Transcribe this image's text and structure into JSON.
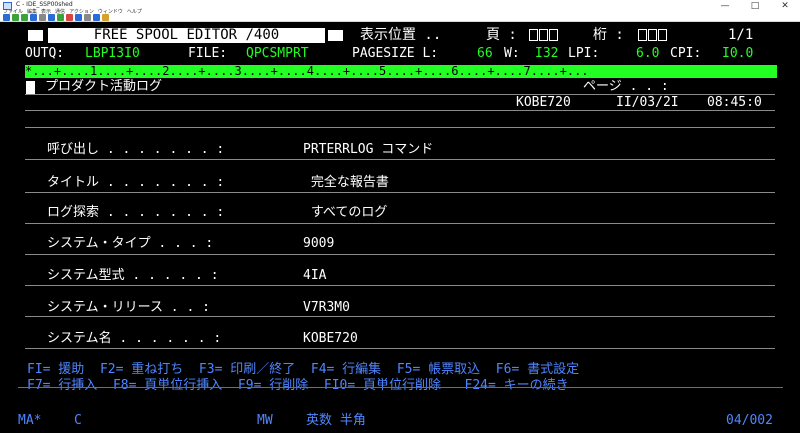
{
  "window": {
    "title": "C - IDE_SSP00shed",
    "menu": [
      "ファイル",
      "編集",
      "表示",
      "通信",
      "アクション",
      "ウィンドウ",
      "ヘルプ"
    ],
    "controls": [
      "—",
      "□",
      "✕"
    ]
  },
  "header": {
    "editor_title": "FREE SPOOL EDITOR /400",
    "position_label": "表示位置 ..",
    "page_label": "頁 :",
    "column_label": "桁 :",
    "page_count": "1/1"
  },
  "file_info": {
    "outq_label": "OUTQ:",
    "outq_value": "LBPI3I0",
    "file_label": "FILE:",
    "file_value": "QPCSMPRT",
    "pagesize_label": "PAGESIZE L:",
    "pagesize_l": "66",
    "w_label": "W:",
    "w_value": "I32",
    "lpi_label": "LPI:",
    "lpi_value": "6.0",
    "cpi_label": "CPI:",
    "cpi_value": "I0.0"
  },
  "ruler": "*...+....1....+....2....+....3....+....4....+....5....+....6....+....7....+...",
  "report": {
    "heading": "プロダクト活動ログ",
    "page_label": "ページ . . :",
    "system": "KOBE720",
    "date": "II/03/2I",
    "time": "08:45:0",
    "rows": [
      {
        "label": "呼び出し . . . . . . . :",
        "value": "PRTERRLOG コマンド"
      },
      {
        "label": "タイトル . . . . . . . :",
        "value": " 完全な報告書"
      },
      {
        "label": "ログ探索 . . . . . . . :",
        "value": " すべてのログ"
      },
      {
        "label": "システム・タイプ . . . :",
        "value": "9009"
      },
      {
        "label": "システム型式 . . . . . :",
        "value": "4IA"
      },
      {
        "label": "システム・リリース . . :",
        "value": "V7R3M0"
      },
      {
        "label": "システム名 . . . . . . :",
        "value": "KOBE720"
      }
    ]
  },
  "function_keys": {
    "line1": "FI= 援助  F2= 重ね打ち  F3= 印刷／終了  F4= 行編集  F5= 帳票取込  F6= 書式設定",
    "line2": "F7= 行挿入  F8= 頁単位行挿入  F9= 行削除  FI0= 頁単位行削除   F24= キーの続き"
  },
  "status": {
    "mode": "MA*",
    "session": "C",
    "mw": "MW",
    "input_mode": "英数 半角",
    "position": "04/002"
  },
  "colors": {
    "background": "#000000",
    "text_white": "#ffffff",
    "text_green": "#22ff22",
    "text_blue": "#4f86ff",
    "ruler_bg": "#22ff22"
  }
}
